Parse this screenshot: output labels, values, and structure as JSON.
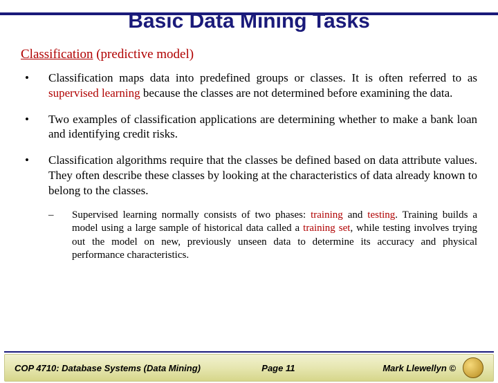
{
  "title": "Basic Data Mining Tasks",
  "subtitle_underlined": "Classification",
  "subtitle_rest": " (predictive model)",
  "bullets": {
    "b1_a": "Classification maps data into predefined groups or classes.  It is often referred to as ",
    "b1_kw": "supervised learning",
    "b1_b": " because the classes are not determined before examining the data.",
    "b2": "Two examples of classification applications are determining whether to make a bank loan and identifying credit risks.",
    "b3": "Classification algorithms require that the classes be defined based on data attribute values.  They often describe these classes by looking at the characteristics of data already known to belong to the classes."
  },
  "sub": {
    "s1_a": "Supervised learning normally consists of two phases: ",
    "s1_kw1": "training",
    "s1_b": " and ",
    "s1_kw2": "testing",
    "s1_c": ". Training builds a model using a large sample of historical data called a ",
    "s1_kw3": "training set",
    "s1_d": ", while testing involves trying out the model on new, previously unseen data to determine its accuracy and physical performance characteristics."
  },
  "footer": {
    "course": "COP 4710: Database Systems  (Data Mining)",
    "page": "Page 11",
    "author": "Mark Llewellyn ©"
  }
}
